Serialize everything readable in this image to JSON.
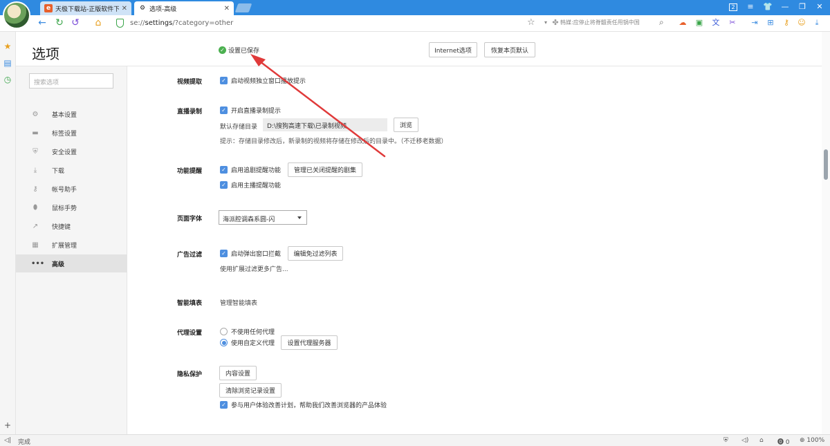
{
  "tabs": [
    {
      "label": "天极下载站-正版软件下载",
      "icon": "e"
    },
    {
      "label": "选项-高级",
      "icon": "gear-icon"
    }
  ],
  "address": {
    "scheme": "se://",
    "host": "settings",
    "path": "/?category=other"
  },
  "news_ticker": "韩媒:应停止将脊髓责任甩锅中国",
  "window_controls": {
    "badge": "2"
  },
  "page": {
    "title": "选项",
    "saved": "设置已保存",
    "internet_options": "Internet选项",
    "restore_defaults": "恢复本页默认"
  },
  "sidebar": {
    "search_placeholder": "搜索选项",
    "items": [
      {
        "label": "基本设置",
        "icon": "⚙"
      },
      {
        "label": "标签设置",
        "icon": "▬"
      },
      {
        "label": "安全设置",
        "icon": "⛨"
      },
      {
        "label": "下载",
        "icon": "⤓"
      },
      {
        "label": "帐号助手",
        "icon": "⚷"
      },
      {
        "label": "鼠标手势",
        "icon": "⬮"
      },
      {
        "label": "快捷键",
        "icon": "↗"
      },
      {
        "label": "扩展管理",
        "icon": "▦"
      },
      {
        "label": "高级",
        "icon": "•••"
      }
    ]
  },
  "content": {
    "video": {
      "title": "视频提取",
      "option": "启动视频独立窗口播放提示"
    },
    "live": {
      "title": "直播录制",
      "option": "开启直播录制提示",
      "dir_label": "默认存储目录",
      "dir_value": "D:\\搜狗高速下载\\已录制视频",
      "browse": "浏览",
      "hint": "提示：存储目录修改后，新录制的视频将存储在修改后的目录中。（不迁移老数据）"
    },
    "reminder": {
      "title": "功能提醒",
      "option1": "启用追剧提醒功能",
      "manage": "管理已关闭提醒的剧集",
      "option2": "启用主播提醒功能"
    },
    "font": {
      "title": "页面字体",
      "value": "海派腔调森系圆-闪"
    },
    "adblock": {
      "title": "广告过滤",
      "option": "启动弹出窗口拦截",
      "edit": "编辑免过滤列表",
      "hint": "使用扩展过滤更多广告..."
    },
    "autofill": {
      "title": "智能填表",
      "link": "管理智能填表"
    },
    "proxy": {
      "title": "代理设置",
      "none": "不使用任何代理",
      "custom": "使用自定义代理",
      "setup": "设置代理服务器"
    },
    "privacy": {
      "title": "隐私保护",
      "content_settings": "内容设置",
      "clear_history": "清除浏览记录设置",
      "ux_program": "参与用户体验改善计划，帮助我们改善浏览器的产品体验"
    }
  },
  "status": {
    "left": "完成",
    "counter": "0",
    "zoom": "100%"
  },
  "colors": {
    "tabbar": "#2f8ae0",
    "accent": "#4e8fe0",
    "saved": "#4cb050",
    "arrow": "#e03a3a"
  }
}
